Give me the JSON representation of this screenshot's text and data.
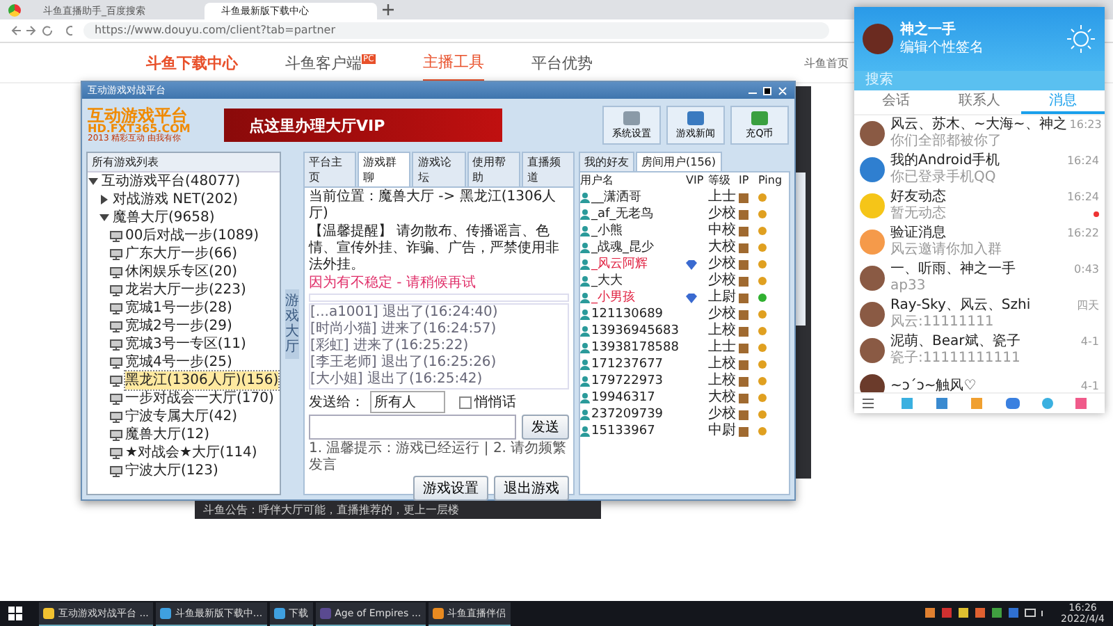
{
  "browser": {
    "tabs": [
      {
        "title": "斗鱼直播助手_百度搜索",
        "selected": false
      },
      {
        "title": "斗鱼最新版下载中心",
        "selected": true
      }
    ],
    "address": "https://www.douyu.com/client?tab=partner",
    "site_nav": {
      "logo": "斗鱼下载中心",
      "items": [
        {
          "label": "斗鱼客户端",
          "badge": "PC",
          "selected": false
        },
        {
          "label": "主播工具",
          "selected": true
        },
        {
          "label": "平台优势",
          "selected": false
        }
      ],
      "links": [
        "斗鱼首页"
      ]
    }
  },
  "app": {
    "title": "互动游戏对战平台",
    "logo": {
      "name": "互动游戏平台",
      "site": "HD.FXT365.COM",
      "slogan": "2013 精彩互动 由我有你"
    },
    "banner": "点这里办理大厅VIP",
    "toolbar": [
      "系统设置",
      "游戏新闻",
      "充Q币"
    ],
    "tree_header": "所有游戏列表",
    "tree": [
      {
        "label": "互动游戏平台(48077)",
        "expanded": true,
        "children": [
          {
            "label": "对战游戏 NET(202)",
            "expanded": false
          },
          {
            "label": "魔兽大厅(9658)",
            "expanded": true,
            "children": [
              {
                "label": "00后对战一步(1089)",
                "selected": false
              },
              {
                "label": "广东大厅一步(66)",
                "selected": false
              },
              {
                "label": "休闲娱乐专区(20)",
                "selected": false
              },
              {
                "label": "龙岩大厅一步(223)",
                "selected": false
              },
              {
                "label": "宽城1号一步(28)",
                "selected": false
              },
              {
                "label": "宽城2号一步(29)",
                "selected": false
              },
              {
                "label": "宽城3号一专区(11)",
                "selected": false
              },
              {
                "label": "宽城4号一步(25)",
                "selected": false
              },
              {
                "label": "黑龙江(1306人厅)(156)",
                "selected": true
              },
              {
                "label": "一步对战会一大厅(170)",
                "selected": false
              },
              {
                "label": "宁波专属大厅(42)",
                "selected": false
              },
              {
                "label": "魔兽大厅(12)",
                "selected": false
              },
              {
                "label": "★对战会★大厅(114)",
                "selected": false
              },
              {
                "label": "宁波大厅(123)",
                "selected": false
              }
            ]
          }
        ]
      }
    ],
    "side_tab": "游戏大厅",
    "tabs": [
      {
        "label": "平台主页",
        "selected": false
      },
      {
        "label": "游戏群聊",
        "selected": true
      },
      {
        "label": "游戏论坛",
        "selected": false
      },
      {
        "label": "使用帮助",
        "selected": false
      },
      {
        "label": "直播频道",
        "selected": false
      }
    ],
    "location": "当前位置：魔兽大厅 -> 黑龙江(1306人厅)",
    "notice": "【温馨提醒】 请勿散布、传播谣言、色情、宣传外挂、诈骗、广告，严禁使用非法外挂。",
    "alert": "因为有不稳定 - 请稍候再试",
    "log": [
      "[...a1001] 退出了(16:24:40)",
      "[时尚小猫] 进来了(16:24:57)",
      "[彩虹] 进来了(16:25:22)",
      "[李王老师] 退出了(16:25:26)",
      "[大小姐] 退出了(16:25:42)"
    ],
    "send_to_label": "发送给：",
    "send_to": "所有人",
    "whisper": {
      "label": "悄悄话",
      "checked": false
    },
    "send_button": "发送",
    "tips": "1. 温馨提示：游戏已经运行 | 2. 请勿频繁发言",
    "buttons": [
      "游戏设置",
      "退出游戏"
    ],
    "user_tabs": [
      {
        "label": "我的好友",
        "selected": false
      },
      {
        "label": "房间用户(156)",
        "selected": true
      }
    ],
    "user_columns": [
      "用户名",
      "VIP",
      "等级",
      "IP",
      "Ping"
    ],
    "users": [
      {
        "name": "__潇洒哥",
        "vip": false,
        "level": "上士",
        "color": "#e0a020",
        "highlight": false
      },
      {
        "name": "_af_无老鸟",
        "vip": false,
        "level": "少校",
        "color": "#e0a020",
        "highlight": false
      },
      {
        "name": "_小熊",
        "vip": false,
        "level": "中校",
        "color": "#e0a020",
        "highlight": false
      },
      {
        "name": "_战魂_昆少",
        "vip": false,
        "level": "大校",
        "color": "#e0a020",
        "highlight": false
      },
      {
        "name": "_风云阿辉",
        "vip": true,
        "level": "少校",
        "color": "#e0a020",
        "highlight": true
      },
      {
        "name": "_大大",
        "vip": false,
        "level": "少校",
        "color": "#e0a020",
        "highlight": false
      },
      {
        "name": "_小男孩",
        "vip": true,
        "level": "上尉",
        "color": "#30b030",
        "highlight": true
      },
      {
        "name": "121130689",
        "vip": false,
        "level": "少校",
        "color": "#e0a020",
        "highlight": false
      },
      {
        "name": "13936945683",
        "vip": false,
        "level": "上校",
        "color": "#e0a020",
        "highlight": false
      },
      {
        "name": "13938178588",
        "vip": false,
        "level": "上士",
        "color": "#e0a020",
        "highlight": false
      },
      {
        "name": "171237677",
        "vip": false,
        "level": "上校",
        "color": "#e0a020",
        "highlight": false
      },
      {
        "name": "179722973",
        "vip": false,
        "level": "上校",
        "color": "#e0a020",
        "highlight": false
      },
      {
        "name": "19946317",
        "vip": false,
        "level": "大校",
        "color": "#e0a020",
        "highlight": false
      },
      {
        "name": "237209739",
        "vip": false,
        "level": "少校",
        "color": "#e0a020",
        "highlight": false
      },
      {
        "name": "15133967",
        "vip": false,
        "level": "中尉",
        "color": "#e0a020",
        "highlight": false
      }
    ]
  },
  "status_strip": "斗鱼公告：呼伴大厅可能，直播推荐的，更上一层楼",
  "qq": {
    "name": "神之一手",
    "signature": "编辑个性签名",
    "search_placeholder": "搜索",
    "tabs": [
      {
        "label": "会话",
        "selected": false
      },
      {
        "label": "联系人",
        "selected": false
      },
      {
        "label": "消息",
        "selected": true
      }
    ],
    "messages": [
      {
        "kind": "group",
        "title": "风云、苏木、~大海~、神之",
        "preview": "你们全部都被你了",
        "time": "16:23",
        "unread": false
      },
      {
        "kind": "phone",
        "title": "我的Android手机",
        "preview": "你已登录手机QQ",
        "time": "16:24",
        "unread": false
      },
      {
        "kind": "star",
        "title": "好友动态",
        "preview": "暂无动态",
        "time": "16:24",
        "unread": true
      },
      {
        "kind": "speaker",
        "title": "验证消息",
        "preview": "风云邀请你加入群",
        "time": "16:22",
        "unread": false
      },
      {
        "kind": "group",
        "title": "一、听雨、神之一手",
        "preview": "ap33",
        "time": "0:43",
        "unread": false
      },
      {
        "kind": "group",
        "title": "Ray-Sky、风云、Szhi",
        "preview": "风云:11111111",
        "time": "四天",
        "unread": false
      },
      {
        "kind": "group",
        "title": "泥萌、Bear斌、瓷子",
        "preview": "瓷子:11111111111",
        "time": "4-1",
        "unread": false
      },
      {
        "kind": "person",
        "title": "~ↄ´ↄ~触风♡",
        "time": "4-1",
        "unread": false
      }
    ]
  },
  "taskbar": {
    "items": [
      {
        "label": "互动游戏对战平台 ...",
        "kind": "app"
      },
      {
        "label": "斗鱼最新版下载中...",
        "kind": "browser"
      },
      {
        "label": "下载",
        "kind": "browser"
      },
      {
        "label": "Age of Empires ...",
        "kind": "game"
      },
      {
        "label": "斗鱼直播伴侣",
        "kind": "stream"
      }
    ],
    "time": "16:26",
    "date": "2022/4/4"
  }
}
